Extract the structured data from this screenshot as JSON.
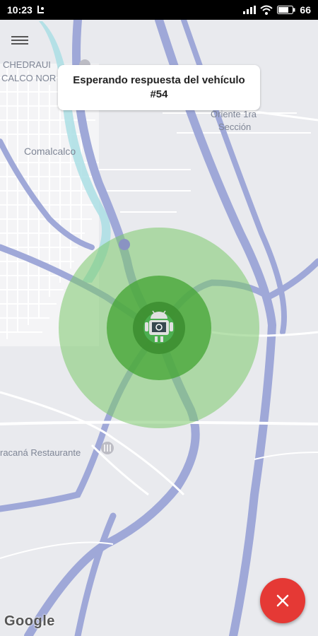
{
  "status_bar": {
    "time": "10:23",
    "battery": "66"
  },
  "map": {
    "labels": {
      "chedraui": "CHEDRAUI",
      "calco_nor": "CALCO NOR",
      "comalcalco": "Comalcalco",
      "oriente_line1": "Oriente 1ra",
      "oriente_line2": "Sección",
      "restaurante": "racaná Restaurante"
    },
    "attribution": "Google",
    "colors": {
      "background": "#e9eaee",
      "road_major": "#9fa8d8",
      "road_minor": "#ffffff",
      "pulse_outer": "#7bc86c",
      "pulse_inner": "#48a83a",
      "water": "#a6dde3"
    }
  },
  "status_card": {
    "message_line1": "Esperando respuesta del vehículo",
    "message_line2": "#54"
  },
  "cancel_button": {
    "icon": "close-icon",
    "color": "#e53935"
  }
}
